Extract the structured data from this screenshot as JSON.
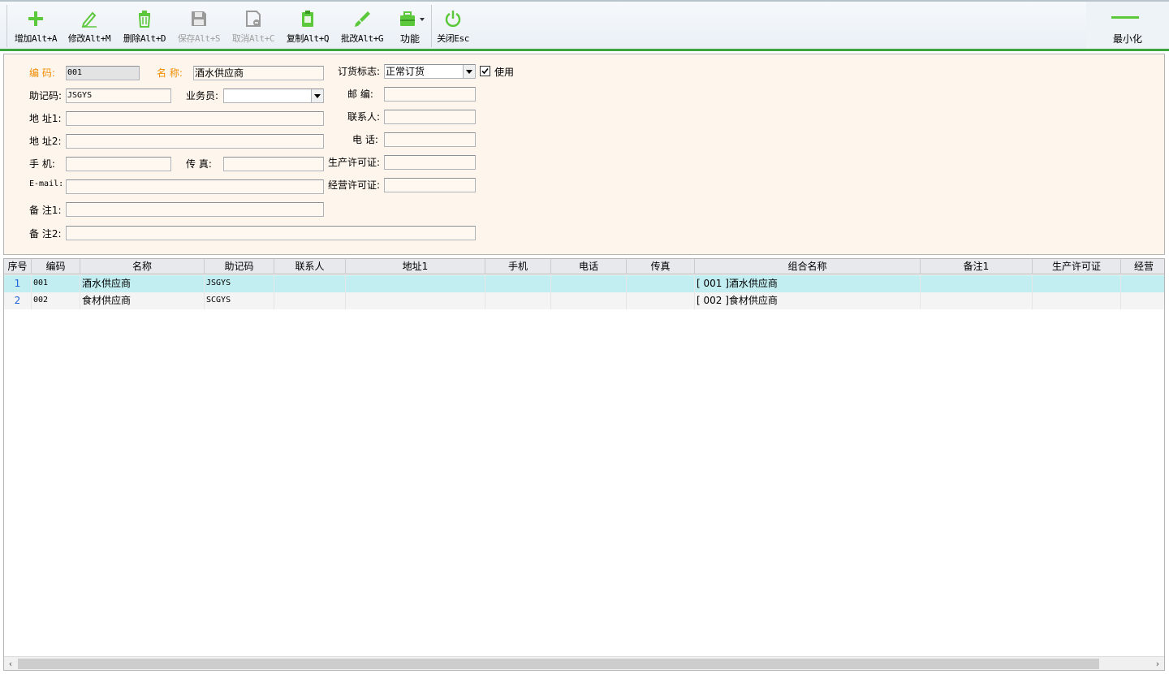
{
  "toolbar": {
    "add": "增加Alt+A",
    "edit": "修改Alt+M",
    "delete": "删除Alt+D",
    "save": "保存Alt+S",
    "cancel": "取消Alt+C",
    "copy": "复制Alt+Q",
    "batch_edit": "批改Alt+G",
    "function": "功能",
    "close": "关闭Esc",
    "minimize": "最小化",
    "accent_color": "#5cc83c"
  },
  "form": {
    "code_label": "编  码:",
    "code_value": "001",
    "name_label": "名  称:",
    "name_value": "酒水供应商",
    "order_flag_label": "订货标志:",
    "order_flag_value": "正常订货",
    "use_label": "使用",
    "use_checked": true,
    "mnemonic_label": "助记码:",
    "mnemonic_value": "JSGYS",
    "salesman_label": "业务员:",
    "salesman_value": "",
    "postcode_label": "邮  编:",
    "postcode_value": "",
    "address1_label": "地 址1:",
    "address1_value": "",
    "contact_label": "联系人:",
    "contact_value": "",
    "address2_label": "地 址2:",
    "address2_value": "",
    "phone_label": "电  话:",
    "phone_value": "",
    "mobile_label": "手  机:",
    "mobile_value": "",
    "fax_label": "传  真:",
    "fax_value": "",
    "prod_license_label": "生产许可证:",
    "prod_license_value": "",
    "email_label": "E-mail:",
    "email_value": "",
    "biz_license_label": "经营许可证:",
    "biz_license_value": "",
    "note1_label": "备 注1:",
    "note1_value": "",
    "note2_label": "备 注2:",
    "note2_value": ""
  },
  "grid": {
    "columns": [
      "序号",
      "编码",
      "名称",
      "助记码",
      "联系人",
      "地址1",
      "手机",
      "电话",
      "传真",
      "组合名称",
      "备注1",
      "生产许可证",
      "经营"
    ],
    "rows": [
      {
        "idx": "1",
        "code": "001",
        "name": "酒水供应商",
        "mnemonic": "JSGYS",
        "contact": "",
        "addr1": "",
        "mobile": "",
        "phone": "",
        "fax": "",
        "combo": "[ 001 ]酒水供应商",
        "note1": "",
        "license": "",
        "biz": ""
      },
      {
        "idx": "2",
        "code": "002",
        "name": "食材供应商",
        "mnemonic": "SCGYS",
        "contact": "",
        "addr1": "",
        "mobile": "",
        "phone": "",
        "fax": "",
        "combo": "[ 002 ]食材供应商",
        "note1": "",
        "license": "",
        "biz": ""
      }
    ]
  }
}
